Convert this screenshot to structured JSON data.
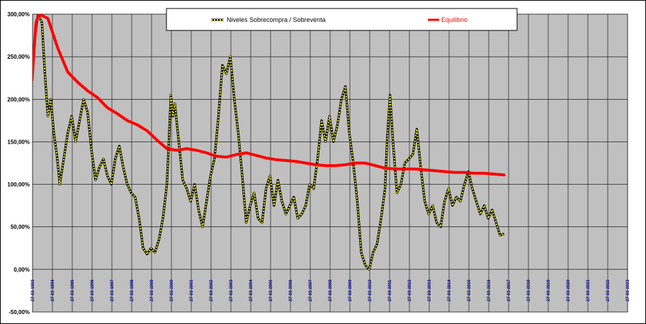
{
  "chart_data": {
    "type": "line",
    "title": "",
    "xlabel": "",
    "ylabel": "",
    "ylim": [
      -50,
      300
    ],
    "y_ticks": [
      "300,00%",
      "250,00%",
      "200,00%",
      "150,00%",
      "100,00%",
      "50,00%",
      "0,00%",
      "-50,00%"
    ],
    "y_tick_values": [
      300,
      250,
      200,
      150,
      100,
      50,
      0,
      -50
    ],
    "x_ticks": [
      "27-03-1993",
      "27-03-1994",
      "27-03-1995",
      "27-03-1996",
      "27-03-1997",
      "27-03-1998",
      "27-03-1999",
      "27-03-2000",
      "27-03-2001",
      "27-03-2002",
      "27-03-2003",
      "27-03-2004",
      "27-03-2005",
      "27-03-2006",
      "27-03-2007",
      "27-03-2008",
      "27-03-2009",
      "27-03-2010",
      "27-03-2011",
      "27-03-2012",
      "27-03-2013",
      "27-03-2014",
      "27-03-2015",
      "27-03-2016",
      "27-03-2017",
      "27-03-2018",
      "27-03-2019",
      "27-03-2020",
      "27-03-2021",
      "27-03-2022",
      "27-03-2023"
    ],
    "x_range": [
      1993.23,
      2023.23
    ],
    "grid": true,
    "legend_position": "top",
    "background_color": "#c0c0c0",
    "series": [
      {
        "name": "Niveles Sobrecompra / Sobreventa",
        "color": "#ffff00",
        "outline_color": "#000000",
        "points": [
          [
            1993.2,
            225
          ],
          [
            1993.35,
            275
          ],
          [
            1993.5,
            300
          ],
          [
            1993.7,
            290
          ],
          [
            1993.85,
            230
          ],
          [
            1994.0,
            180
          ],
          [
            1994.15,
            200
          ],
          [
            1994.3,
            160
          ],
          [
            1994.45,
            135
          ],
          [
            1994.6,
            100
          ],
          [
            1994.8,
            130
          ],
          [
            1995.0,
            160
          ],
          [
            1995.2,
            180
          ],
          [
            1995.4,
            150
          ],
          [
            1995.6,
            175
          ],
          [
            1995.8,
            200
          ],
          [
            1996.0,
            185
          ],
          [
            1996.2,
            140
          ],
          [
            1996.4,
            105
          ],
          [
            1996.6,
            120
          ],
          [
            1996.8,
            130
          ],
          [
            1997.0,
            110
          ],
          [
            1997.2,
            100
          ],
          [
            1997.4,
            130
          ],
          [
            1997.6,
            145
          ],
          [
            1997.8,
            120
          ],
          [
            1998.0,
            100
          ],
          [
            1998.2,
            90
          ],
          [
            1998.4,
            85
          ],
          [
            1998.6,
            60
          ],
          [
            1998.8,
            25
          ],
          [
            1999.0,
            18
          ],
          [
            1999.2,
            25
          ],
          [
            1999.4,
            20
          ],
          [
            1999.6,
            35
          ],
          [
            1999.8,
            60
          ],
          [
            2000.0,
            100
          ],
          [
            2000.1,
            150
          ],
          [
            2000.2,
            205
          ],
          [
            2000.3,
            180
          ],
          [
            2000.4,
            195
          ],
          [
            2000.6,
            150
          ],
          [
            2000.8,
            105
          ],
          [
            2001.0,
            95
          ],
          [
            2001.2,
            80
          ],
          [
            2001.4,
            100
          ],
          [
            2001.6,
            70
          ],
          [
            2001.8,
            50
          ],
          [
            2002.0,
            80
          ],
          [
            2002.2,
            110
          ],
          [
            2002.4,
            130
          ],
          [
            2002.6,
            180
          ],
          [
            2002.8,
            240
          ],
          [
            2003.0,
            230
          ],
          [
            2003.2,
            250
          ],
          [
            2003.4,
            200
          ],
          [
            2003.6,
            160
          ],
          [
            2003.8,
            110
          ],
          [
            2004.0,
            55
          ],
          [
            2004.2,
            75
          ],
          [
            2004.4,
            90
          ],
          [
            2004.6,
            60
          ],
          [
            2004.8,
            55
          ],
          [
            2005.0,
            95
          ],
          [
            2005.2,
            110
          ],
          [
            2005.4,
            75
          ],
          [
            2005.6,
            105
          ],
          [
            2005.8,
            80
          ],
          [
            2006.0,
            65
          ],
          [
            2006.2,
            75
          ],
          [
            2006.4,
            85
          ],
          [
            2006.6,
            60
          ],
          [
            2006.8,
            65
          ],
          [
            2007.0,
            75
          ],
          [
            2007.2,
            100
          ],
          [
            2007.4,
            95
          ],
          [
            2007.6,
            130
          ],
          [
            2007.8,
            175
          ],
          [
            2008.0,
            150
          ],
          [
            2008.2,
            180
          ],
          [
            2008.4,
            150
          ],
          [
            2008.6,
            170
          ],
          [
            2008.8,
            200
          ],
          [
            2009.0,
            215
          ],
          [
            2009.2,
            160
          ],
          [
            2009.4,
            125
          ],
          [
            2009.6,
            80
          ],
          [
            2009.8,
            20
          ],
          [
            2010.0,
            5
          ],
          [
            2010.2,
            0
          ],
          [
            2010.4,
            20
          ],
          [
            2010.6,
            30
          ],
          [
            2010.8,
            60
          ],
          [
            2011.0,
            95
          ],
          [
            2011.1,
            150
          ],
          [
            2011.25,
            205
          ],
          [
            2011.4,
            150
          ],
          [
            2011.6,
            90
          ],
          [
            2011.8,
            100
          ],
          [
            2012.0,
            125
          ],
          [
            2012.2,
            130
          ],
          [
            2012.4,
            135
          ],
          [
            2012.6,
            165
          ],
          [
            2012.8,
            120
          ],
          [
            2013.0,
            80
          ],
          [
            2013.2,
            65
          ],
          [
            2013.4,
            75
          ],
          [
            2013.6,
            55
          ],
          [
            2013.8,
            50
          ],
          [
            2014.0,
            80
          ],
          [
            2014.2,
            95
          ],
          [
            2014.4,
            75
          ],
          [
            2014.6,
            85
          ],
          [
            2014.8,
            80
          ],
          [
            2015.0,
            100
          ],
          [
            2015.2,
            115
          ],
          [
            2015.4,
            95
          ],
          [
            2015.6,
            80
          ],
          [
            2015.8,
            65
          ],
          [
            2016.0,
            75
          ],
          [
            2016.2,
            60
          ],
          [
            2016.4,
            70
          ],
          [
            2016.6,
            55
          ],
          [
            2016.8,
            40
          ],
          [
            2017.0,
            42
          ]
        ]
      },
      {
        "name": "Equilibrio",
        "color": "#ff0000",
        "points": [
          [
            1993.2,
            222
          ],
          [
            1993.4,
            290
          ],
          [
            1993.55,
            300
          ],
          [
            1994.0,
            295
          ],
          [
            1994.5,
            260
          ],
          [
            1995.0,
            232
          ],
          [
            1995.5,
            220
          ],
          [
            1996.0,
            210
          ],
          [
            1996.5,
            202
          ],
          [
            1997.0,
            190
          ],
          [
            1997.5,
            183
          ],
          [
            1998.0,
            175
          ],
          [
            1998.5,
            170
          ],
          [
            1999.0,
            163
          ],
          [
            1999.5,
            152
          ],
          [
            2000.0,
            142
          ],
          [
            2000.5,
            140
          ],
          [
            2001.0,
            142
          ],
          [
            2001.5,
            140
          ],
          [
            2002.0,
            137
          ],
          [
            2002.5,
            133
          ],
          [
            2003.0,
            132
          ],
          [
            2003.5,
            135
          ],
          [
            2004.0,
            137
          ],
          [
            2004.5,
            134
          ],
          [
            2005.0,
            131
          ],
          [
            2005.5,
            129
          ],
          [
            2006.0,
            128
          ],
          [
            2006.5,
            127
          ],
          [
            2007.0,
            125
          ],
          [
            2007.5,
            123
          ],
          [
            2008.0,
            122
          ],
          [
            2008.5,
            122
          ],
          [
            2009.0,
            123
          ],
          [
            2009.5,
            125
          ],
          [
            2010.0,
            125
          ],
          [
            2010.5,
            122
          ],
          [
            2011.0,
            119
          ],
          [
            2011.5,
            118
          ],
          [
            2012.0,
            118
          ],
          [
            2012.5,
            118
          ],
          [
            2013.0,
            117
          ],
          [
            2013.5,
            116
          ],
          [
            2014.0,
            115
          ],
          [
            2014.5,
            114
          ],
          [
            2015.0,
            114
          ],
          [
            2015.5,
            113
          ],
          [
            2016.0,
            113
          ],
          [
            2016.5,
            112
          ],
          [
            2017.0,
            111
          ]
        ]
      }
    ]
  }
}
